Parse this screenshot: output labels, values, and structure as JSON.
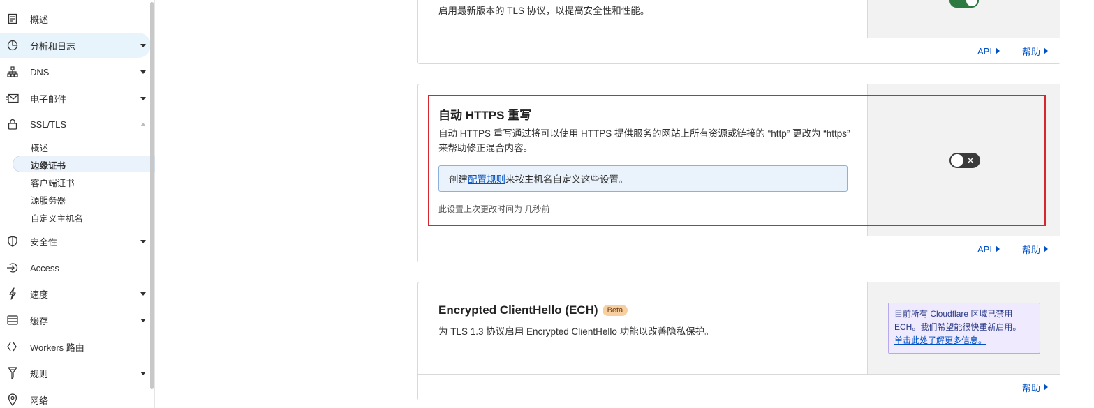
{
  "sidebar": {
    "items": [
      {
        "label": "概述",
        "icon": "document-icon"
      },
      {
        "label": "分析和日志",
        "icon": "pie-chart-icon"
      },
      {
        "label": "DNS",
        "icon": "network-icon"
      },
      {
        "label": "电子邮件",
        "icon": "email-icon"
      },
      {
        "label": "SSL/TLS",
        "icon": "lock-icon"
      },
      {
        "label": "安全性",
        "icon": "shield-icon"
      },
      {
        "label": "Access",
        "icon": "access-icon"
      },
      {
        "label": "速度",
        "icon": "lightning-icon"
      },
      {
        "label": "缓存",
        "icon": "cache-icon"
      },
      {
        "label": "Workers 路由",
        "icon": "workers-icon"
      },
      {
        "label": "规则",
        "icon": "rules-icon"
      },
      {
        "label": "网络",
        "icon": "location-icon"
      }
    ],
    "ssl_subitems": [
      "概述",
      "边缘证书",
      "客户端证书",
      "源服务器",
      "自定义主机名"
    ]
  },
  "tls_card": {
    "description": "启用最新版本的 TLS 协议，以提高安全性和性能。",
    "api_label": "API",
    "help_label": "帮助"
  },
  "https_card": {
    "title": "自动 HTTPS 重写",
    "description": "自动 HTTPS 重写通过将可以使用 HTTPS 提供服务的网站上所有资源或链接的 “http” 更改为 “https” 来帮助修正混合内容。",
    "info_prefix": "创建",
    "info_link": "配置规则",
    "info_suffix": "来按主机名自定义这些设置。",
    "meta": "此设置上次更改时间为 几秒前",
    "toggle_state": "off",
    "api_label": "API",
    "help_label": "帮助"
  },
  "ech_card": {
    "title": "Encrypted ClientHello (ECH)",
    "badge": "Beta",
    "description": "为 TLS 1.3 协议启用 Encrypted ClientHello 功能以改善隐私保护。",
    "notice_text": "目前所有 Cloudflare 区域已禁用 ECH。我们希望能很快重新启用。",
    "notice_link": "单击此处了解更多信息。",
    "help_label": "帮助"
  },
  "colors": {
    "link": "#0051c3",
    "highlight": "#d9262e",
    "toggle_on": "#2c7a3f"
  }
}
